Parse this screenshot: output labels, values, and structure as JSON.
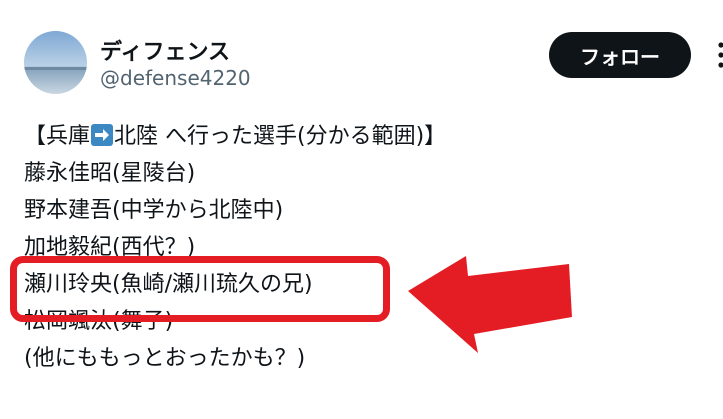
{
  "user": {
    "display_name": "ディフェンス",
    "handle": "@defense4220",
    "avatar_icon": "avatar-sky-icon"
  },
  "follow_button": {
    "label": "フォロー"
  },
  "more_menu": {
    "icon": "more-vertical-icon"
  },
  "tweet": {
    "line1_prefix": "【兵庫",
    "line1_emoji": "right-arrow-emoji-icon",
    "line1_suffix": "北陸 へ行った選手(分かる範囲)】",
    "lines": [
      "藤永佳昭(星陵台)",
      "野本建吾(中学から北陸中)",
      "加地毅紀(西代？)",
      "瀬川玲央(魚崎/瀬川琉久の兄)",
      "松岡颯汰(舞子)",
      "(他にももっとおったかも？)"
    ]
  },
  "highlight": {
    "color": "#e41d25"
  }
}
